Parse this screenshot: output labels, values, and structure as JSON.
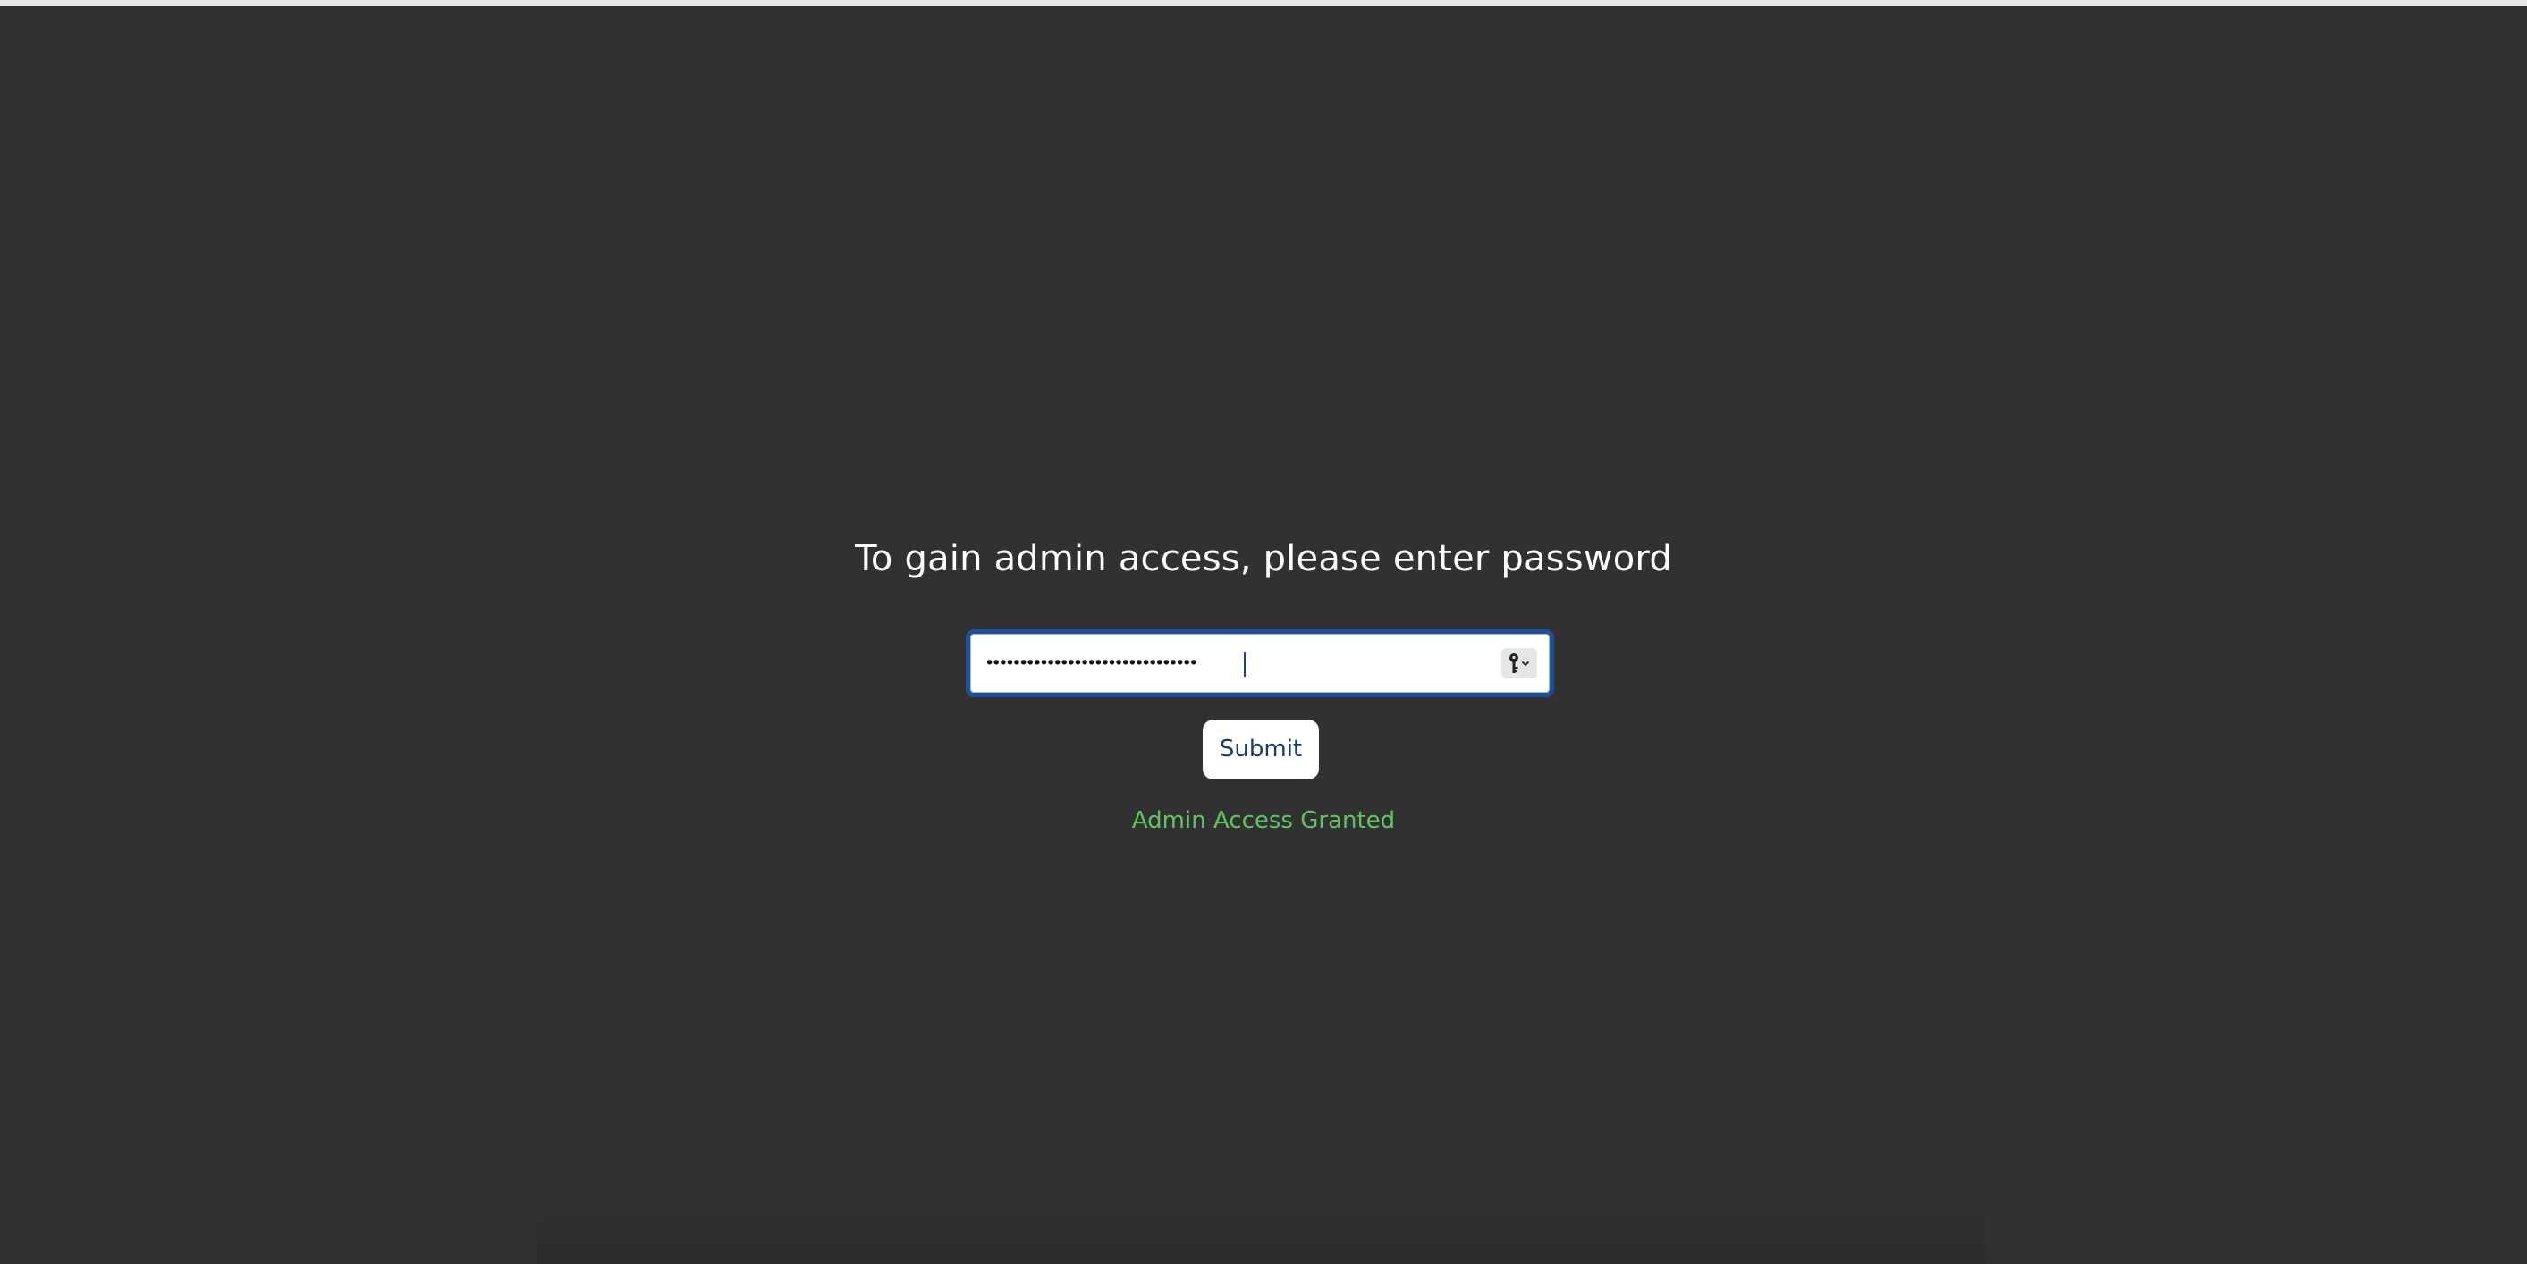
{
  "page": {
    "background_color": "#313131"
  },
  "login": {
    "prompt": "To gain admin access, please enter password",
    "password": {
      "masked_value": "•••••••••••••••••••••••••••••••",
      "focus_border_color": "#1f4f9a",
      "autofill_icon": "key-icon"
    },
    "submit_label": "Submit",
    "status_message": "Admin Access Granted",
    "status_color": "#5fc35f"
  }
}
